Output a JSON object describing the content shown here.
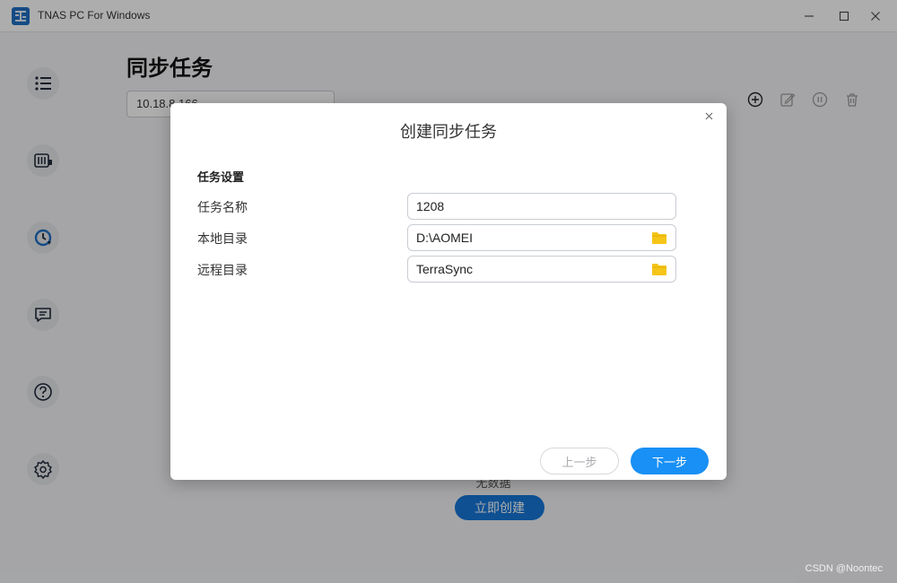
{
  "window": {
    "title": "TNAS PC For Windows",
    "minimize_icon": "minimize-icon",
    "maximize_icon": "maximize-icon",
    "close_icon": "close-icon"
  },
  "sidebar": {
    "items": [
      {
        "icon": "list-icon"
      },
      {
        "icon": "nas-device-icon"
      },
      {
        "icon": "sync-icon"
      },
      {
        "icon": "message-icon"
      },
      {
        "icon": "help-icon"
      },
      {
        "icon": "settings-icon"
      }
    ]
  },
  "main": {
    "title": "同步任务",
    "device_select": "10.18.8.166",
    "toolbar": [
      "add-icon",
      "edit-icon",
      "pause-icon",
      "delete-icon"
    ],
    "empty_text": "无数据",
    "create_now_label": "立即创建"
  },
  "dialog": {
    "title": "创建同步任务",
    "section_title": "任务设置",
    "fields": [
      {
        "label": "任务名称",
        "value": "1208"
      },
      {
        "label": "本地目录",
        "value": "D:\\AOMEI",
        "icon": "folder-icon"
      },
      {
        "label": "远程目录",
        "value": "TerraSync",
        "icon": "folder-icon"
      }
    ],
    "prev_label": "上一步",
    "next_label": "下一步"
  },
  "watermark": "CSDN @Noontec",
  "colors": {
    "primary": "#1890f5",
    "folder": "#f5c518"
  }
}
